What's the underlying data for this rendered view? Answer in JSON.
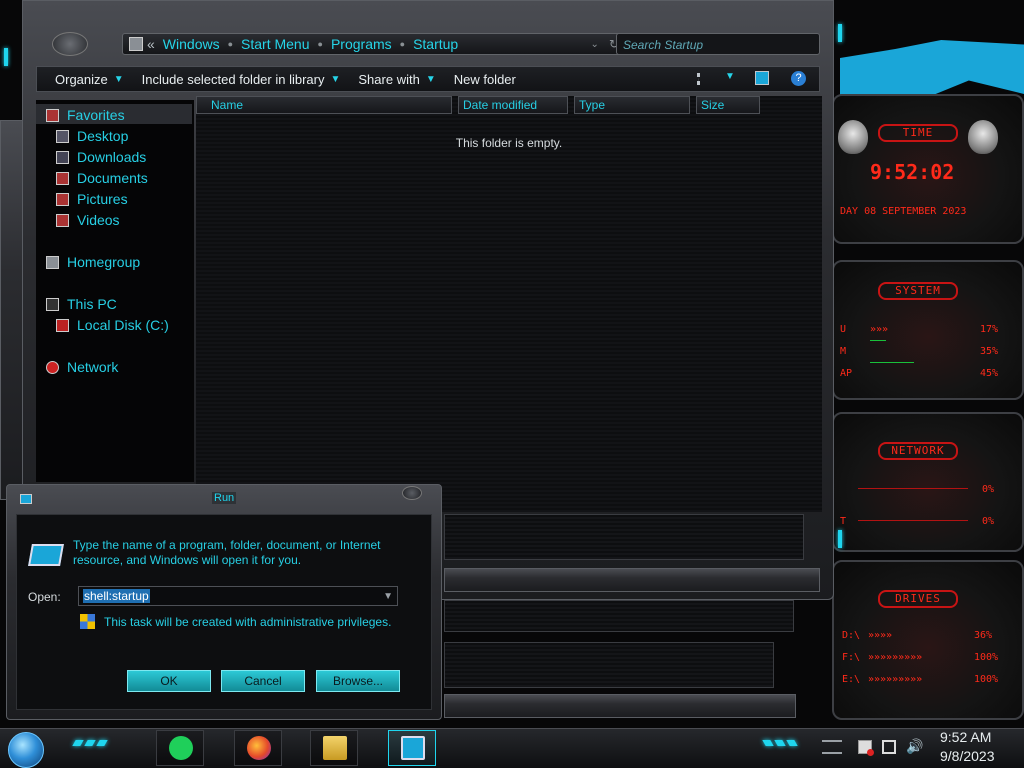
{
  "explorer": {
    "breadcrumbs": [
      "«",
      "Windows",
      "Start Menu",
      "Programs",
      "Startup"
    ],
    "search_placeholder": "Search Startup",
    "toolbar": {
      "organize": "Organize",
      "include": "Include selected folder in library",
      "share": "Share with",
      "new_folder": "New folder"
    },
    "nav": {
      "favorites": "Favorites",
      "desktop": "Desktop",
      "downloads": "Downloads",
      "documents": "Documents",
      "pictures": "Pictures",
      "videos": "Videos",
      "homegroup": "Homegroup",
      "this_pc": "This PC",
      "local_disk": "Local Disk (C:)",
      "network": "Network"
    },
    "columns": [
      "Name",
      "Date modified",
      "Type",
      "Size"
    ],
    "empty_message": "This folder is empty."
  },
  "gadgets": {
    "time": {
      "title": "TIME",
      "clock": "9:52:02",
      "date": "DAY 08 SEPTEMBER 2023"
    },
    "system": {
      "title": "SYSTEM",
      "rows": [
        {
          "label": "U",
          "value": "17%"
        },
        {
          "label": "M",
          "value": "35%"
        },
        {
          "label": "AP",
          "value": "45%"
        }
      ]
    },
    "network": {
      "title": "NETWORK",
      "rows": [
        {
          "label": "",
          "value": "0%"
        },
        {
          "label": "T",
          "value": "0%"
        }
      ]
    },
    "drives": {
      "title": "DRIVES",
      "rows": [
        {
          "label": "D:\\",
          "value": "36%"
        },
        {
          "label": "F:\\",
          "value": "100%"
        },
        {
          "label": "E:\\",
          "value": "100%"
        }
      ]
    }
  },
  "run": {
    "title": "Run",
    "message": "Type the name of a program, folder, document, or Internet resource, and Windows will open it for you.",
    "open_label": "Open:",
    "open_value": "shell:startup",
    "admin_note": "This task will be created with administrative privileges.",
    "ok": "OK",
    "cancel": "Cancel",
    "browse": "Browse..."
  },
  "taskbar": {
    "time": "9:52 AM",
    "date": "9/8/2023"
  },
  "colors": {
    "accent": "#1fd6ef",
    "text_cyan": "#27cfe4",
    "red": "#ff2a1a"
  }
}
